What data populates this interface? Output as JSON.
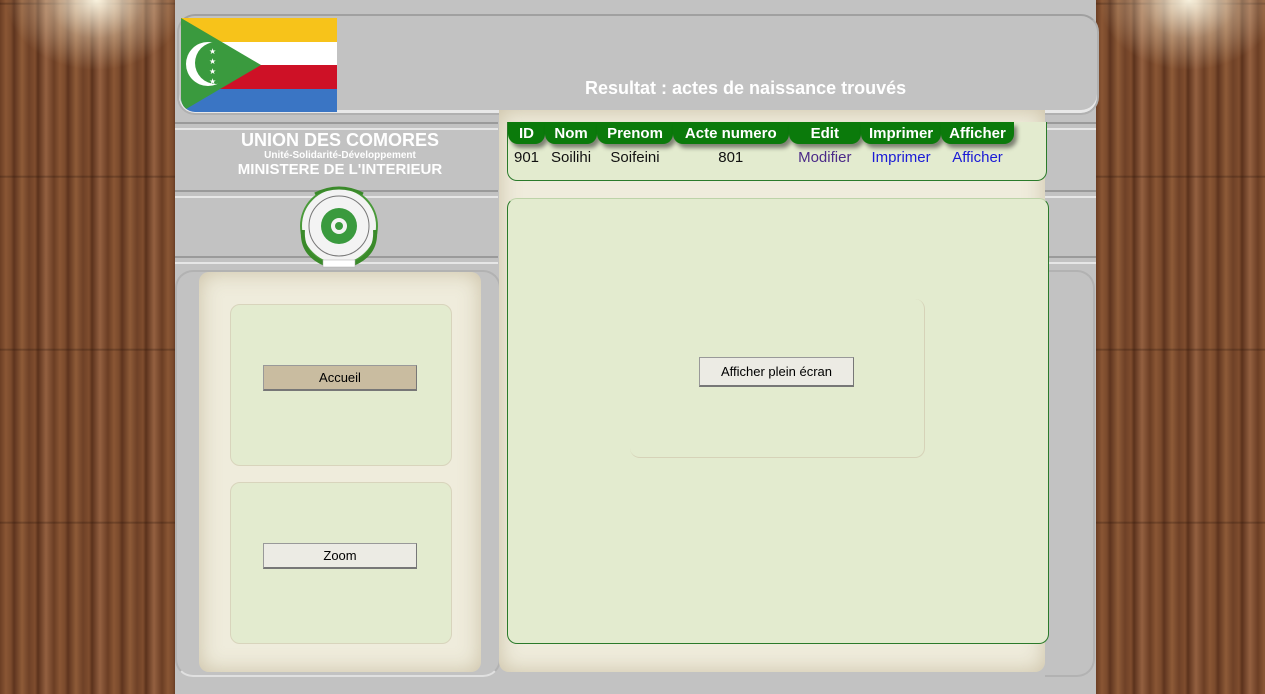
{
  "header": {
    "title": "Resultat : actes de naissance trouvés"
  },
  "government": {
    "line1": "UNION DES COMORES",
    "line2": "Unité-Solidarité-Développement",
    "line3": "MINISTERE DE L'INTERIEUR"
  },
  "colors": {
    "flag_yellow": "#f7c31a",
    "flag_white": "#ffffff",
    "flag_red": "#ce1126",
    "flag_blue": "#3a75c4",
    "flag_green": "#3a9a3e",
    "table_header": "#0b7a0b",
    "panel_bg": "#e3ebcf"
  },
  "nav": {
    "home_label": "Accueil",
    "zoom_label": "Zoom"
  },
  "results": {
    "columns": [
      "ID",
      "Nom",
      "Prenom",
      "Acte numero",
      "Edit",
      "Imprimer",
      "Afficher"
    ],
    "rows": [
      {
        "id": "901",
        "nom": "Soilihi",
        "prenom": "Soifeini",
        "acte": "801",
        "edit": "Modifier",
        "print": "Imprimer",
        "show": "Afficher"
      }
    ]
  },
  "viewer": {
    "fullscreen_label": "Afficher plein écran"
  }
}
